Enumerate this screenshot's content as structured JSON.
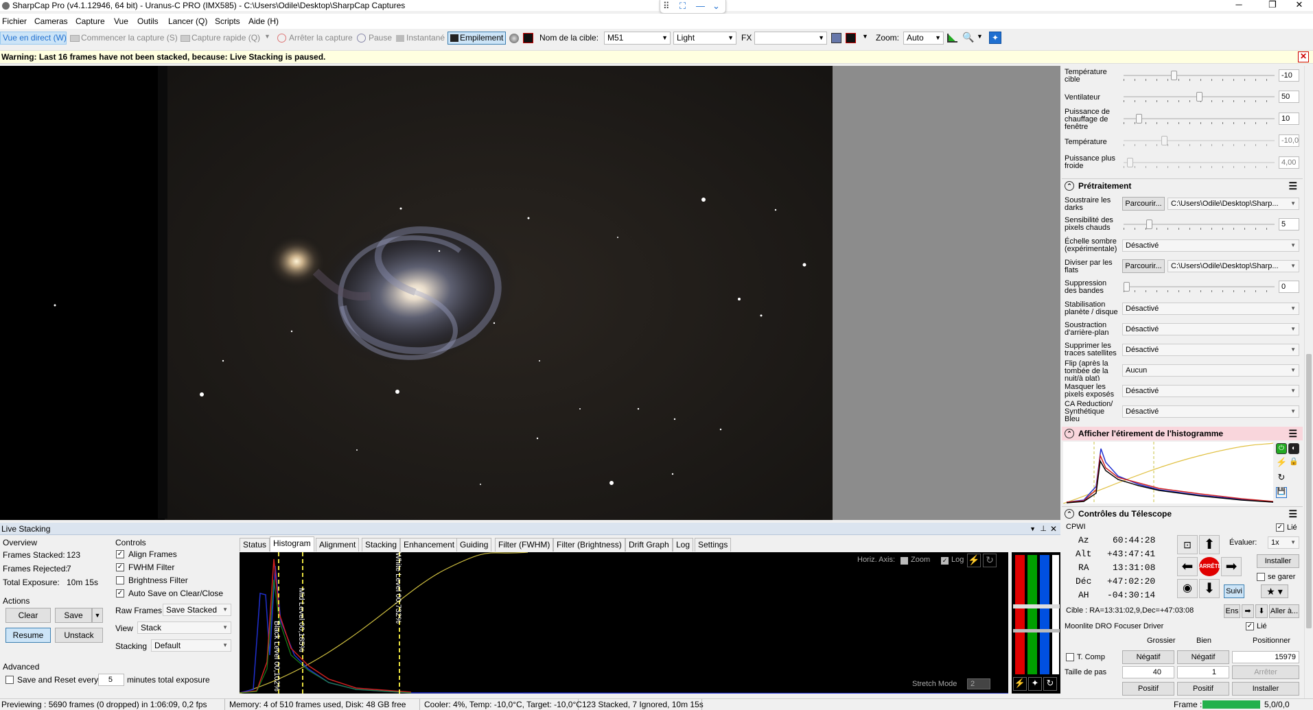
{
  "window": {
    "title": "SharpCap Pro (v4.1.12946, 64 bit) - Uranus-C PRO (IMX585) - C:\\Users\\Odile\\Desktop\\SharpCap Captures",
    "min": "─",
    "max": "❐",
    "close": "✕"
  },
  "snapbar": {
    "grid": "⠿",
    "fit": "⛶",
    "minus": "—",
    "chevron": "⌄"
  },
  "menu": [
    "Fichier",
    "Cameras",
    "Capture",
    "Vue",
    "Outils",
    "Lancer (Q)",
    "Scripts",
    "Aide (H)"
  ],
  "toolbar": {
    "live_view": "Vue en direct (W)",
    "start_capture": "Commencer la capture (S)",
    "quick_capture": "Capture rapide (Q)",
    "stop_capture": "Arrêter la capture",
    "pause": "Pause",
    "snapshot": "Instantané",
    "stacking": "Empilement",
    "target_label": "Nom de la cible:",
    "target_value": "M51",
    "frame_type": "Light",
    "fx_label": "FX",
    "fx_value": "",
    "zoom_label": "Zoom:",
    "zoom_value": "Auto"
  },
  "warning": {
    "text": "Warning: Last 16 frames have not been stacked, because: Live Stacking is paused.",
    "close": "✕"
  },
  "camera_controls": {
    "target_temp": {
      "label": "Température cible",
      "value": "-10",
      "level": 0.33
    },
    "fan": {
      "label": "Ventilateur",
      "value": "50",
      "level": 0.5
    },
    "heater": {
      "label": "Puissance de chauffage de fenêtre",
      "value": "10",
      "level": 0.1
    },
    "temperature": {
      "label": "Température",
      "value": "-10,0",
      "level": 0.27
    },
    "cooler_power": {
      "label": "Puissance plus froide",
      "value": "4,00",
      "level": 0.04
    }
  },
  "preprocessing": {
    "title": "Prétraitement",
    "darks": {
      "label": "Soustraire les darks",
      "browse": "Parcourir...",
      "path": "C:\\Users\\Odile\\Desktop\\Sharp..."
    },
    "hot_pixels": {
      "label": "Sensibilité des pixels chauds",
      "value": "5",
      "level": 0.17
    },
    "dark_scale": {
      "label": "Échelle sombre (expérimentale)",
      "value": "Désactivé"
    },
    "flats": {
      "label": "Diviser par les flats",
      "browse": "Parcourir...",
      "path": "C:\\Users\\Odile\\Desktop\\Sharp..."
    },
    "banding": {
      "label": "Suppression des bandes",
      "value": "0",
      "level": 0.0
    },
    "stabilization": {
      "label": "Stabilisation planète / disque",
      "value": "Désactivé"
    },
    "background": {
      "label": "Soustraction d'arrière-plan",
      "value": "Désactivé"
    },
    "satellites": {
      "label": "Supprimer les traces satellites",
      "value": "Désactivé"
    },
    "flip": {
      "label": "Flip (après la tombée de la nuit/à plat)",
      "value": "Aucun"
    },
    "mask": {
      "label": "Masquer les pixels exposés",
      "value": "Désactivé"
    },
    "ca": {
      "label": "CA Reduction/ Synthétique Bleu",
      "value": "Désactivé"
    }
  },
  "histogram_stretch": {
    "title": "Afficher l'étirement de l'histogramme"
  },
  "telescope": {
    "title": "Contrôles du Télescope",
    "mount": "CPWI",
    "linked": "Lié",
    "az_label": "Az",
    "az": "60:44:28",
    "alt_label": "Alt",
    "alt": "+43:47:41",
    "ra_label": "RA",
    "ra": "13:31:08",
    "dec_label": "Déc",
    "dec": "+47:02:20",
    "ha_label": "AH",
    "ha": "-04:30:14",
    "rate_label": "Évaluer:",
    "rate": "1x",
    "install": "Installer",
    "park": "se garer",
    "tracking": "Suivi",
    "stop": "ARRÊTE",
    "target": "Cible : RA=13:31:02,9,Dec=+47:03:08",
    "set": "Ens",
    "goto": "Aller à..."
  },
  "focuser": {
    "title": "Moonlite DRO Focuser Driver",
    "linked": "Lié",
    "coarse": "Grossier",
    "fine": "Bien",
    "position": "Positionner",
    "tcomp": "T. Comp",
    "neg": "Négatif",
    "pos_value": "15979",
    "step_label": "Taille de pas",
    "step_coarse": "40",
    "step_fine": "1",
    "stop": "Arrêter",
    "positive": "Positif",
    "install": "Installer"
  },
  "live_stacking": {
    "title": "Live Stacking",
    "overview": "Overview",
    "frames_stacked_label": "Frames Stacked:",
    "frames_stacked": "123",
    "frames_rejected_label": "Frames Rejected:",
    "frames_rejected": "7",
    "total_exposure_label": "Total Exposure:",
    "total_exposure": "10m 15s",
    "actions": "Actions",
    "clear": "Clear",
    "save": "Save",
    "resume": "Resume",
    "unstack": "Unstack",
    "advanced": "Advanced",
    "save_reset": "Save and Reset every",
    "save_reset_n": "5",
    "save_reset_suffix": "minutes total exposure",
    "controls": "Controls",
    "align": "Align Frames",
    "fwhm": "FWHM Filter",
    "brightness": "Brightness Filter",
    "autosave": "Auto Save on Clear/Close",
    "raw_label": "Raw Frames",
    "raw_value": "Save Stacked",
    "view_label": "View",
    "view_value": "Stack",
    "stacking_label": "Stacking",
    "stacking_value": "Default",
    "tabs": [
      "Status",
      "Histogram",
      "Alignment",
      "Stacking",
      "Enhancement",
      "Guiding",
      "Filter (FWHM)",
      "Filter (Brightness)",
      "Drift Graph",
      "Log",
      "Settings"
    ],
    "active_tab": 1,
    "horiz_axis": "Horiz. Axis:",
    "zoom": "Zoom",
    "log": "Log",
    "black_level": "Black Level 00,102%",
    "mid_level": "Mid Level 00,185%",
    "white_level": "White Level 00,732%",
    "stretch_mode": "Stretch Mode",
    "stretch_value": "2"
  },
  "status": {
    "preview": "Previewing : 5690 frames (0 dropped) in 1:06:09, 0,2 fps",
    "memory": "Memory: 4 of 510 frames used, Disk: 48 GB free",
    "cooler": "Cooler: 4%, Temp: -10,0°C, Target: -10,0°C",
    "stacked": "123 Stacked, 7 Ignored, 10m 15s",
    "frame_label": "Frame :",
    "frame_value": "5,0/0,0"
  },
  "colors": {
    "accent": "#1f6fd0",
    "warning_bg": "#ffffe0",
    "stop_red": "#e00000",
    "frame_green": "#22b14c"
  }
}
